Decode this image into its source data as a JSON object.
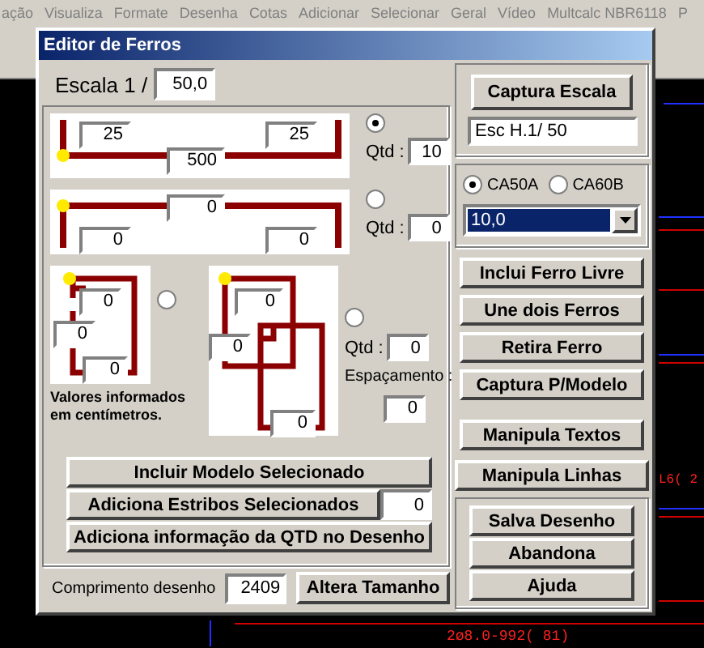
{
  "menu_bar": [
    "ação",
    "Visualiza",
    "Formate",
    "Desenha",
    "Cotas",
    "Adicionar",
    "Selecionar",
    "Geral",
    "Vídeo",
    "Multcalc NBR6118",
    "P"
  ],
  "canvas_labels": [
    {
      "text": "L6( 2",
      "color": "#ff2020"
    },
    {
      "text": "2ø8.0-992( 81)",
      "color": "#ff2020"
    }
  ],
  "window": {
    "title": "Editor de Ferros"
  },
  "scale": {
    "label": "Escala 1 /",
    "value": "50,0"
  },
  "shapes": [
    {
      "kind": "hooks_up",
      "selected": true,
      "inputs": [
        "25",
        "25",
        "500"
      ],
      "qty_label": "Qtd :",
      "qty": "10"
    },
    {
      "kind": "hooks_down",
      "selected": false,
      "inputs": [
        "0",
        "0",
        "0"
      ],
      "qty_label": "Qtd :",
      "qty": "0"
    }
  ],
  "stirrups": [
    {
      "kind": "single",
      "selected": false,
      "inputs": [
        "0",
        "0",
        "0"
      ]
    },
    {
      "kind": "double",
      "selected": false,
      "inputs": [
        "0",
        "0",
        "0"
      ]
    }
  ],
  "stirrup_qty": {
    "label": "Qtd :",
    "value": "0"
  },
  "spacing": {
    "label": "Espaçamento :",
    "value": "0"
  },
  "note": "Valores informados em centímetros.",
  "actions": [
    {
      "label": "Incluir Modelo Selecionado"
    },
    {
      "label": "Adiciona Estribos Selecionados",
      "value": "0"
    },
    {
      "label": "Adiciona informação da QTD no Desenho"
    }
  ],
  "length": {
    "label": "Comprimento desenho",
    "value": "2409",
    "button": "Altera Tamanho"
  },
  "capture_button": "Captura Escala",
  "scale_text": "Esc H.1/ 50",
  "steel": [
    {
      "label": "CA50A",
      "selected": true
    },
    {
      "label": "CA60B",
      "selected": false
    }
  ],
  "diameter": "10,0",
  "tools": [
    "Inclui Ferro Livre",
    "Une dois Ferros",
    "Retira Ferro",
    "Captura P/Modelo",
    "Manipula Textos"
  ],
  "lines_button": "Manipula Linhas",
  "file_buttons": [
    "Salva Desenho",
    "Abandona",
    "Ajuda"
  ]
}
